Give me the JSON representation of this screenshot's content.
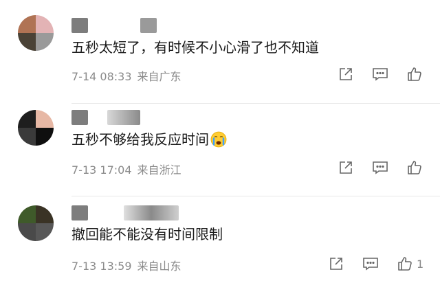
{
  "comments": [
    {
      "text": "五秒太短了，有时候不小心滑了也不知道",
      "date": "7-14 08:33",
      "location": "来自广东",
      "like_count": "",
      "emoji": "",
      "avatar_colors": [
        "#b07354",
        "#e3b3b5",
        "#4a4236",
        "#9a9a9a"
      ]
    },
    {
      "text": "五秒不够给我反应时间",
      "date": "7-13 17:04",
      "location": "来自浙江",
      "like_count": "",
      "emoji": "crying-face",
      "avatar_colors": [
        "#1e1e1e",
        "#e7b8a5",
        "#3a3a3a",
        "#0f0f0f"
      ]
    },
    {
      "text": "撤回能不能没有时间限制",
      "date": "7-13 13:59",
      "location": "来自山东",
      "like_count": "1",
      "emoji": "",
      "avatar_colors": [
        "#3f5a2a",
        "#3a3325",
        "#4a4a4a",
        "#585858"
      ]
    }
  ],
  "icons": {
    "share": "share-icon",
    "comment": "comment-icon",
    "like": "thumbs-up-icon"
  },
  "colors": {
    "text": "#1a1a1a",
    "meta": "#8a8a8a",
    "icon": "#666666",
    "divider": "#e8e8e8"
  }
}
